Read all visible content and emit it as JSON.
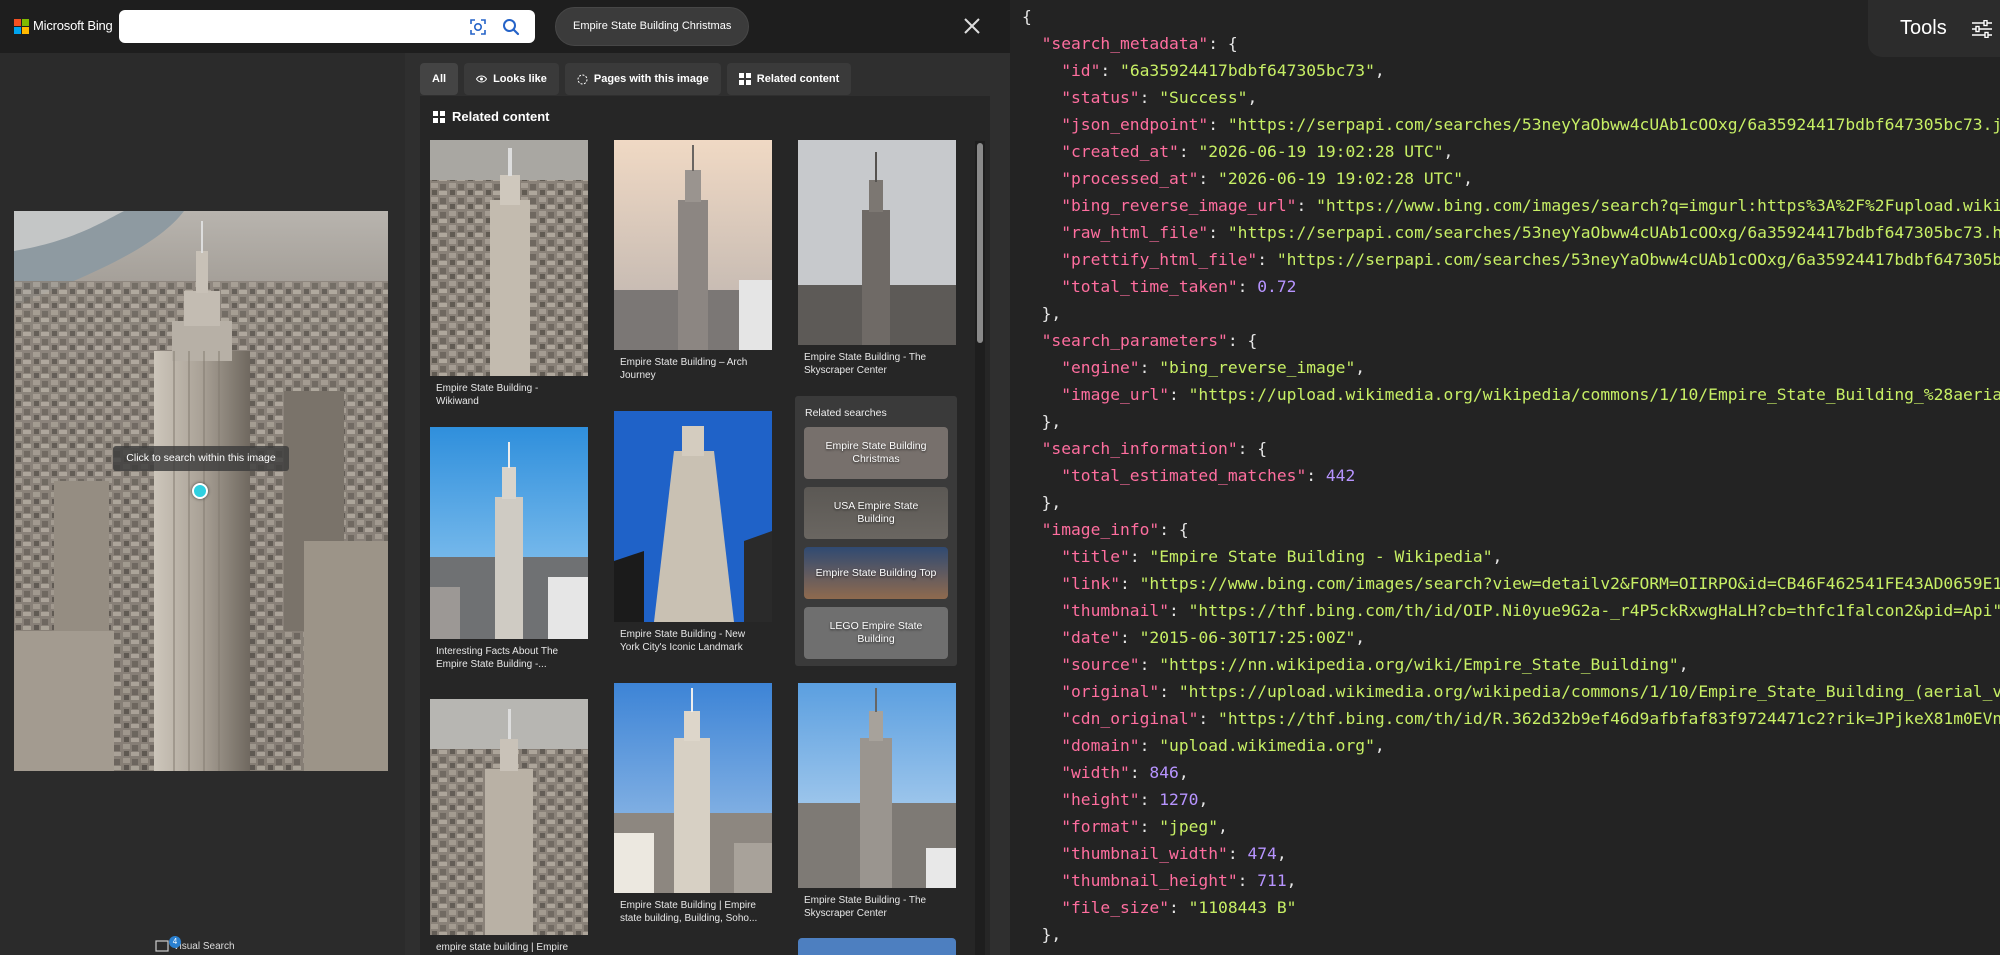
{
  "bing": {
    "logo_text": "Microsoft Bing",
    "search_value": "",
    "top_chip": "Empire State Building Christmas",
    "tip": "Click to search within this image",
    "visual_search_label": "Visual Search",
    "visual_search_badge": "4",
    "tabs": [
      {
        "label": "All",
        "icon": "none"
      },
      {
        "label": "Looks like",
        "icon": "eye-icon"
      },
      {
        "label": "Pages with this image",
        "icon": "globe-icon"
      },
      {
        "label": "Related content",
        "icon": "grid-icon"
      }
    ],
    "related_content_heading": "Related content",
    "results": [
      {
        "caption": "Empire State Building - Wikiwand"
      },
      {
        "caption": "Empire State Building – Arch Journey"
      },
      {
        "caption": "Empire State Building - The Skyscraper Center"
      },
      {
        "caption": "Interesting Facts About The Empire State Building -..."
      },
      {
        "caption": "Empire State Building - New York City's Iconic Landmark"
      },
      {
        "caption": "empire state building | Empire"
      },
      {
        "caption": "Empire State Building | Empire state building, Building, Soho..."
      },
      {
        "caption": "Empire State Building - The Skyscraper Center"
      }
    ],
    "related_searches_title": "Related searches",
    "related_searches": [
      "Empire State Building Christmas",
      "USA Empire State Building",
      "Empire State Building Top",
      "LEGO Empire State Building"
    ]
  },
  "json_viewer": {
    "tools_label": "Tools",
    "lines": [
      {
        "indent": 0,
        "parts": [
          [
            "p",
            "{"
          ]
        ]
      },
      {
        "indent": 1,
        "parts": [
          [
            "k",
            "\"search_metadata\""
          ],
          [
            "p",
            ": {"
          ]
        ]
      },
      {
        "indent": 2,
        "parts": [
          [
            "k",
            "\"id\""
          ],
          [
            "p",
            ": "
          ],
          [
            "s",
            "\"6a35924417bdbf647305bc73\""
          ],
          [
            "p",
            ","
          ]
        ]
      },
      {
        "indent": 2,
        "parts": [
          [
            "k",
            "\"status\""
          ],
          [
            "p",
            ": "
          ],
          [
            "s",
            "\"Success\""
          ],
          [
            "p",
            ","
          ]
        ]
      },
      {
        "indent": 2,
        "parts": [
          [
            "k",
            "\"json_endpoint\""
          ],
          [
            "p",
            ": "
          ],
          [
            "s",
            "\"https://serpapi.com/searches/53neyYaObww4cUAb1cOOxg/6a35924417bdbf647305bc73.json\""
          ],
          [
            "p",
            ","
          ]
        ]
      },
      {
        "indent": 2,
        "parts": [
          [
            "k",
            "\"created_at\""
          ],
          [
            "p",
            ": "
          ],
          [
            "s",
            "\"2026-06-19 19:02:28 UTC\""
          ],
          [
            "p",
            ","
          ]
        ]
      },
      {
        "indent": 2,
        "parts": [
          [
            "k",
            "\"processed_at\""
          ],
          [
            "p",
            ": "
          ],
          [
            "s",
            "\"2026-06-19 19:02:28 UTC\""
          ],
          [
            "p",
            ","
          ]
        ]
      },
      {
        "indent": 2,
        "parts": [
          [
            "k",
            "\"bing_reverse_image_url\""
          ],
          [
            "p",
            ": "
          ],
          [
            "s",
            "\"https://www.bing.com/images/search?q=imgurl:https%3A%2F%2Fupload.wikimedia.org\""
          ],
          [
            "p",
            ","
          ]
        ]
      },
      {
        "indent": 2,
        "parts": [
          [
            "k",
            "\"raw_html_file\""
          ],
          [
            "p",
            ": "
          ],
          [
            "s",
            "\"https://serpapi.com/searches/53neyYaObww4cUAb1cOOxg/6a35924417bdbf647305bc73.html\""
          ],
          [
            "p",
            ","
          ]
        ]
      },
      {
        "indent": 2,
        "parts": [
          [
            "k",
            "\"prettify_html_file\""
          ],
          [
            "p",
            ": "
          ],
          [
            "s",
            "\"https://serpapi.com/searches/53neyYaObww4cUAb1cOOxg/6a35924417bdbf647305bc73.html\""
          ],
          [
            "p",
            ","
          ]
        ]
      },
      {
        "indent": 2,
        "parts": [
          [
            "k",
            "\"total_time_taken\""
          ],
          [
            "p",
            ": "
          ],
          [
            "n",
            "0.72"
          ]
        ]
      },
      {
        "indent": 1,
        "parts": [
          [
            "p",
            "},"
          ]
        ]
      },
      {
        "indent": 1,
        "parts": [
          [
            "k",
            "\"search_parameters\""
          ],
          [
            "p",
            ": {"
          ]
        ]
      },
      {
        "indent": 2,
        "parts": [
          [
            "k",
            "\"engine\""
          ],
          [
            "p",
            ": "
          ],
          [
            "s",
            "\"bing_reverse_image\""
          ],
          [
            "p",
            ","
          ]
        ]
      },
      {
        "indent": 2,
        "parts": [
          [
            "k",
            "\"image_url\""
          ],
          [
            "p",
            ": "
          ],
          [
            "s",
            "\"https://upload.wikimedia.org/wikipedia/commons/1/10/Empire_State_Building_%28aerial_view%29.jpg\""
          ]
        ]
      },
      {
        "indent": 1,
        "parts": [
          [
            "p",
            "},"
          ]
        ]
      },
      {
        "indent": 1,
        "parts": [
          [
            "k",
            "\"search_information\""
          ],
          [
            "p",
            ": {"
          ]
        ]
      },
      {
        "indent": 2,
        "parts": [
          [
            "k",
            "\"total_estimated_matches\""
          ],
          [
            "p",
            ": "
          ],
          [
            "n",
            "442"
          ]
        ]
      },
      {
        "indent": 1,
        "parts": [
          [
            "p",
            "},"
          ]
        ]
      },
      {
        "indent": 1,
        "parts": [
          [
            "k",
            "\"image_info\""
          ],
          [
            "p",
            ": {"
          ]
        ]
      },
      {
        "indent": 2,
        "parts": [
          [
            "k",
            "\"title\""
          ],
          [
            "p",
            ": "
          ],
          [
            "s",
            "\"Empire State Building - Wikipedia\""
          ],
          [
            "p",
            ","
          ]
        ]
      },
      {
        "indent": 2,
        "parts": [
          [
            "k",
            "\"link\""
          ],
          [
            "p",
            ": "
          ],
          [
            "s",
            "\"https://www.bing.com/images/search?view=detailv2&FORM=OIIRPO&id=CB46F462541FE43AD0659E1543\""
          ],
          [
            "p",
            ","
          ]
        ]
      },
      {
        "indent": 2,
        "parts": [
          [
            "k",
            "\"thumbnail\""
          ],
          [
            "p",
            ": "
          ],
          [
            "s",
            "\"https://thf.bing.com/th/id/OIP.Ni0yue9G2a-_r4P5ckRxwgHaLH?cb=thfc1falcon2&pid=Api\""
          ],
          [
            "p",
            ","
          ]
        ]
      },
      {
        "indent": 2,
        "parts": [
          [
            "k",
            "\"date\""
          ],
          [
            "p",
            ": "
          ],
          [
            "s",
            "\"2015-06-30T17:25:00Z\""
          ],
          [
            "p",
            ","
          ]
        ]
      },
      {
        "indent": 2,
        "parts": [
          [
            "k",
            "\"source\""
          ],
          [
            "p",
            ": "
          ],
          [
            "s",
            "\"https://nn.wikipedia.org/wiki/Empire_State_Building\""
          ],
          [
            "p",
            ","
          ]
        ]
      },
      {
        "indent": 2,
        "parts": [
          [
            "k",
            "\"original\""
          ],
          [
            "p",
            ": "
          ],
          [
            "s",
            "\"https://upload.wikimedia.org/wikipedia/commons/1/10/Empire_State_Building_(aerial_view).jpg\""
          ],
          [
            "p",
            ","
          ]
        ]
      },
      {
        "indent": 2,
        "parts": [
          [
            "k",
            "\"cdn_original\""
          ],
          [
            "p",
            ": "
          ],
          [
            "s",
            "\"https://thf.bing.com/th/id/R.362d32b9ef46d9afbfaf83f9724471c2?rik=JPjkeX81m0EVng&pid=ImgRaw\""
          ],
          [
            "p",
            ","
          ]
        ]
      },
      {
        "indent": 2,
        "parts": [
          [
            "k",
            "\"domain\""
          ],
          [
            "p",
            ": "
          ],
          [
            "s",
            "\"upload.wikimedia.org\""
          ],
          [
            "p",
            ","
          ]
        ]
      },
      {
        "indent": 2,
        "parts": [
          [
            "k",
            "\"width\""
          ],
          [
            "p",
            ": "
          ],
          [
            "n",
            "846"
          ],
          [
            "p",
            ","
          ]
        ]
      },
      {
        "indent": 2,
        "parts": [
          [
            "k",
            "\"height\""
          ],
          [
            "p",
            ": "
          ],
          [
            "n",
            "1270"
          ],
          [
            "p",
            ","
          ]
        ]
      },
      {
        "indent": 2,
        "parts": [
          [
            "k",
            "\"format\""
          ],
          [
            "p",
            ": "
          ],
          [
            "s",
            "\"jpeg\""
          ],
          [
            "p",
            ","
          ]
        ]
      },
      {
        "indent": 2,
        "parts": [
          [
            "k",
            "\"thumbnail_width\""
          ],
          [
            "p",
            ": "
          ],
          [
            "n",
            "474"
          ],
          [
            "p",
            ","
          ]
        ]
      },
      {
        "indent": 2,
        "parts": [
          [
            "k",
            "\"thumbnail_height\""
          ],
          [
            "p",
            ": "
          ],
          [
            "n",
            "711"
          ],
          [
            "p",
            ","
          ]
        ]
      },
      {
        "indent": 2,
        "parts": [
          [
            "k",
            "\"file_size\""
          ],
          [
            "p",
            ": "
          ],
          [
            "s",
            "\"1108443 B\""
          ]
        ]
      },
      {
        "indent": 1,
        "parts": [
          [
            "p",
            "},"
          ]
        ]
      }
    ]
  }
}
